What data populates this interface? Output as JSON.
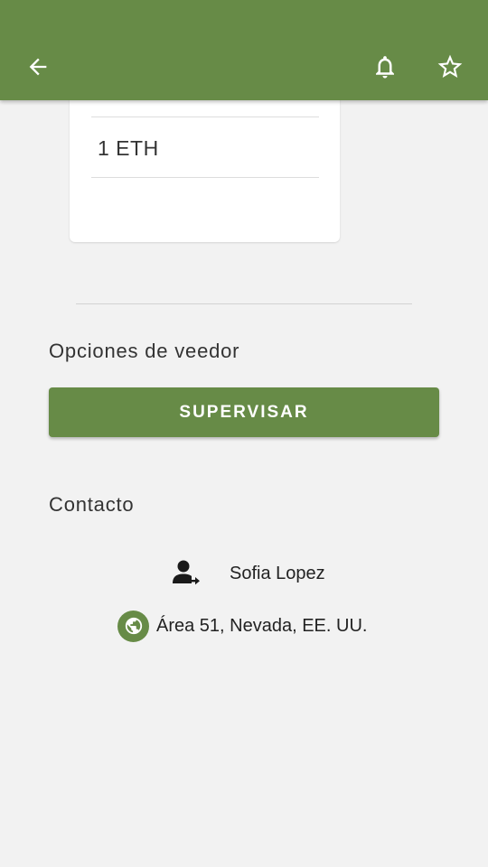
{
  "app_bar": {
    "back_icon": "arrow-back-icon",
    "notifications_icon": "bell-icon",
    "favorite_icon": "star-outline-icon",
    "color": "#678b47"
  },
  "card": {
    "value": "1 ETH"
  },
  "veedor": {
    "title": "Opciones de veedor",
    "supervise_label": "SUPERVISAR"
  },
  "contact": {
    "title": "Contacto",
    "name": "Sofia Lopez",
    "location": "Área 51, Nevada, EE. UU.",
    "person_icon": "person-arrow-icon",
    "location_icon": "globe-icon"
  },
  "colors": {
    "accent": "#678b47",
    "background": "#f2f2f2"
  }
}
